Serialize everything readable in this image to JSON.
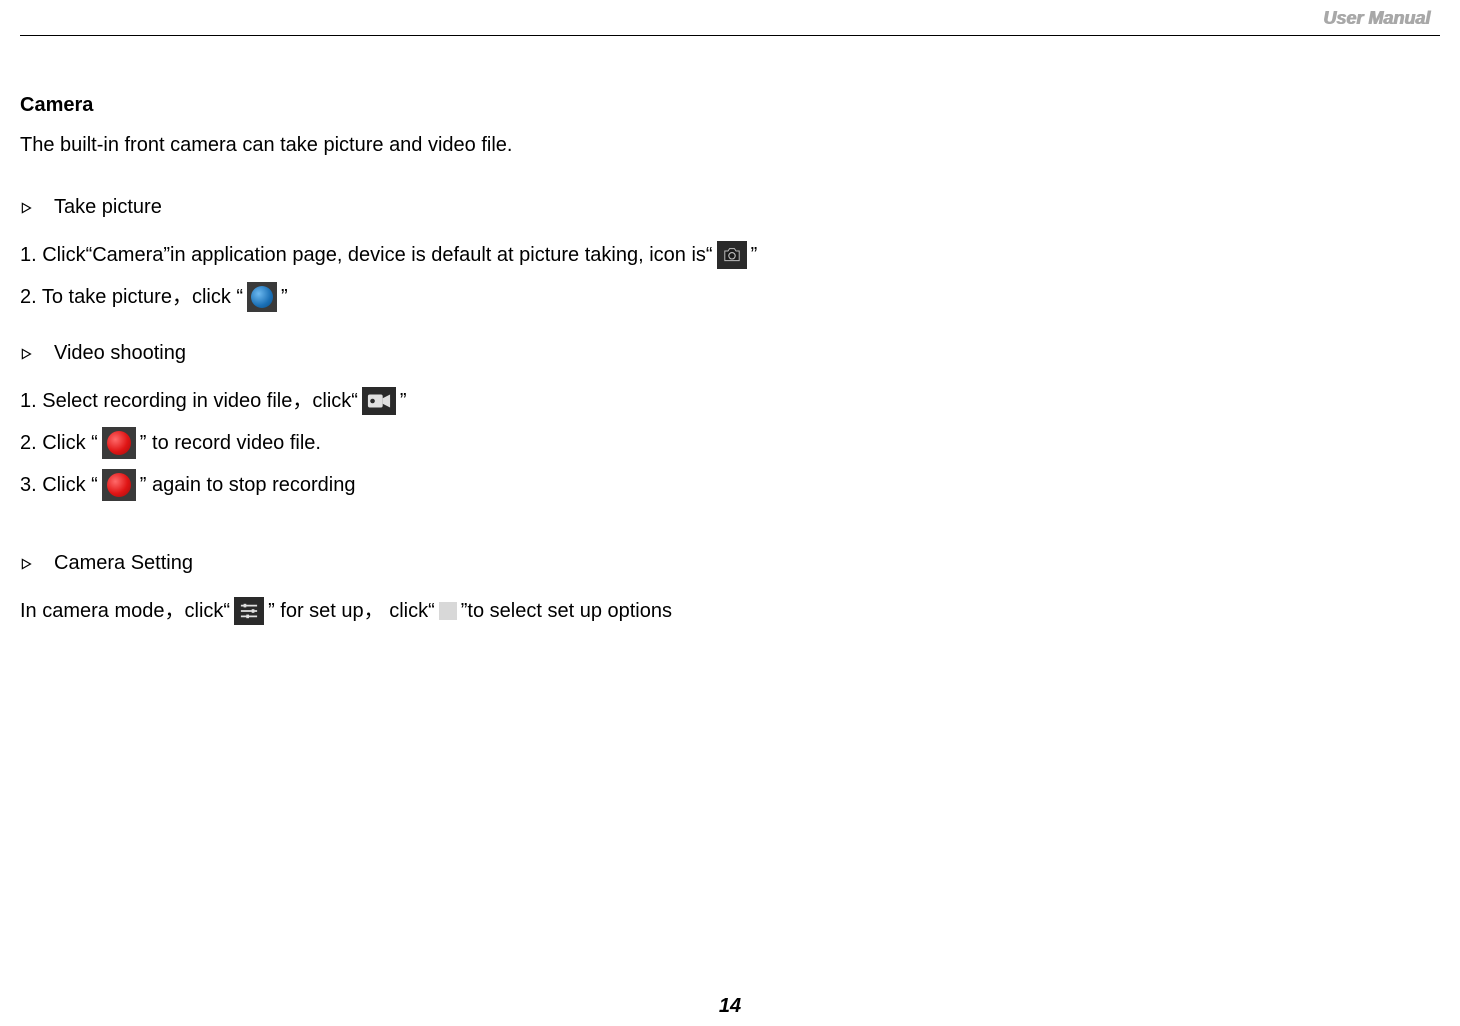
{
  "header": {
    "title": "User Manual"
  },
  "page_number": "14",
  "sections": {
    "camera": {
      "title": "Camera",
      "intro": "The built-in front camera can take picture and video file."
    },
    "take_picture": {
      "heading": "Take picture",
      "step1_a": "1. Click“Camera”in application page, device is default at picture taking, icon is“",
      "step1_b": "”",
      "step2_a": "2. To take picture，click  “",
      "step2_b": "”"
    },
    "video": {
      "heading": "Video shooting",
      "step1_a": "1. Select recording in video file，click“",
      "step1_b": "”",
      "step2_a": "2. Click  “",
      "step2_b": "” to record video file.",
      "step3_a": "3. Click  “",
      "step3_b": "” again to stop recording"
    },
    "settings": {
      "heading": "Camera Setting",
      "line_a": "In camera mode，click“",
      "line_b": "”  for set up，  click“",
      "line_c": " ”to select set up options"
    }
  }
}
